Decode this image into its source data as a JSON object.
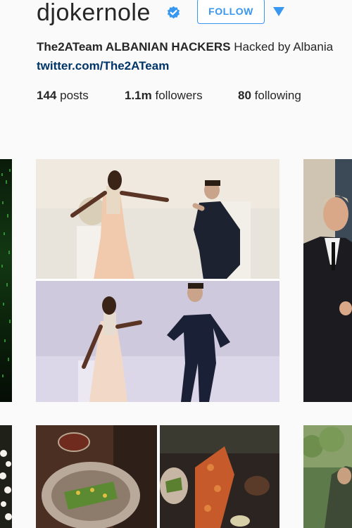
{
  "profile": {
    "username": "djokernole",
    "verified_icon": "verified-badge-icon",
    "follow_label": "FOLLOW",
    "full_name": "The2ATeam ALBANIAN HACKERS",
    "bio_text": "Hacked by Albania",
    "link": "twitter.com/The2ATeam"
  },
  "stats": {
    "posts_count": "144",
    "posts_label": "posts",
    "followers_count": "1.1m",
    "followers_label": "followers",
    "following_count": "80",
    "following_label": "following"
  },
  "colors": {
    "accent": "#3897f0",
    "link": "#003569",
    "background": "#fafafa"
  }
}
